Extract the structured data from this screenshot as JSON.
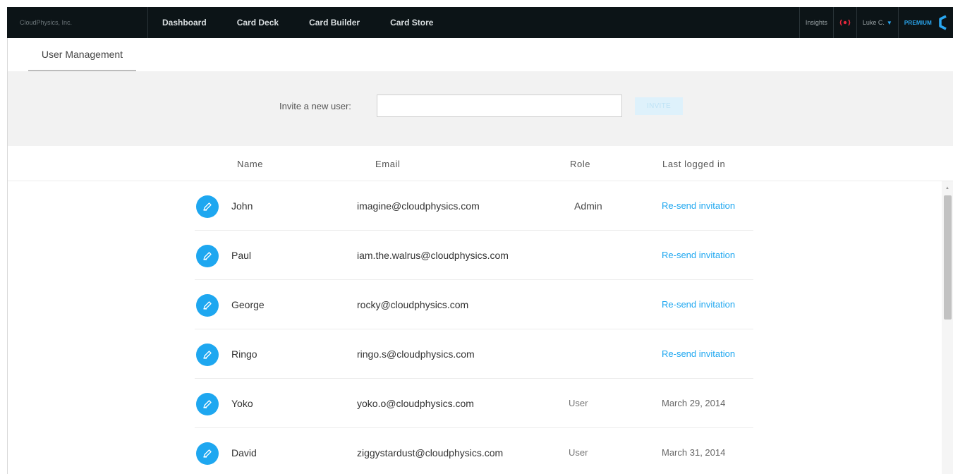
{
  "topbar": {
    "brand": "CloudPhysics, Inc.",
    "nav": [
      "Dashboard",
      "Card Deck",
      "Card Builder",
      "Card Store"
    ],
    "insights": "Insights",
    "user": "Luke C.",
    "premium": "PREMIUM"
  },
  "tabs": {
    "active": "User Management"
  },
  "invite": {
    "label": "Invite a new user:",
    "value": "",
    "button": "INVITE"
  },
  "table": {
    "headers": {
      "name": "Name",
      "email": "Email",
      "role": "Role",
      "last": "Last logged in"
    },
    "rows": [
      {
        "name": "John",
        "email": "imagine@cloudphysics.com",
        "role": "Admin",
        "last": "Re-send invitation"
      },
      {
        "name": "Paul",
        "email": "iam.the.walrus@cloudphysics.com",
        "role": "",
        "last": "Re-send invitation"
      },
      {
        "name": "George",
        "email": "rocky@cloudphysics.com",
        "role": "",
        "last": "Re-send invitation"
      },
      {
        "name": "Ringo",
        "email": "ringo.s@cloudphysics.com",
        "role": "",
        "last": "Re-send invitation"
      },
      {
        "name": "Yoko",
        "email": "yoko.o@cloudphysics.com",
        "role": "User",
        "last": "March 29, 2014"
      },
      {
        "name": "David",
        "email": "ziggystardust@cloudphysics.com",
        "role": "User",
        "last": "March 31, 2014"
      }
    ]
  },
  "colors": {
    "accent": "#1ea7f0",
    "navbar": "#0c1417",
    "alert": "#e8283c"
  },
  "icons": {
    "edit": "pencil-icon",
    "alert": "alert-icon",
    "caret": "chevron-down-icon",
    "logo": "cloudphysics-logo-icon"
  }
}
